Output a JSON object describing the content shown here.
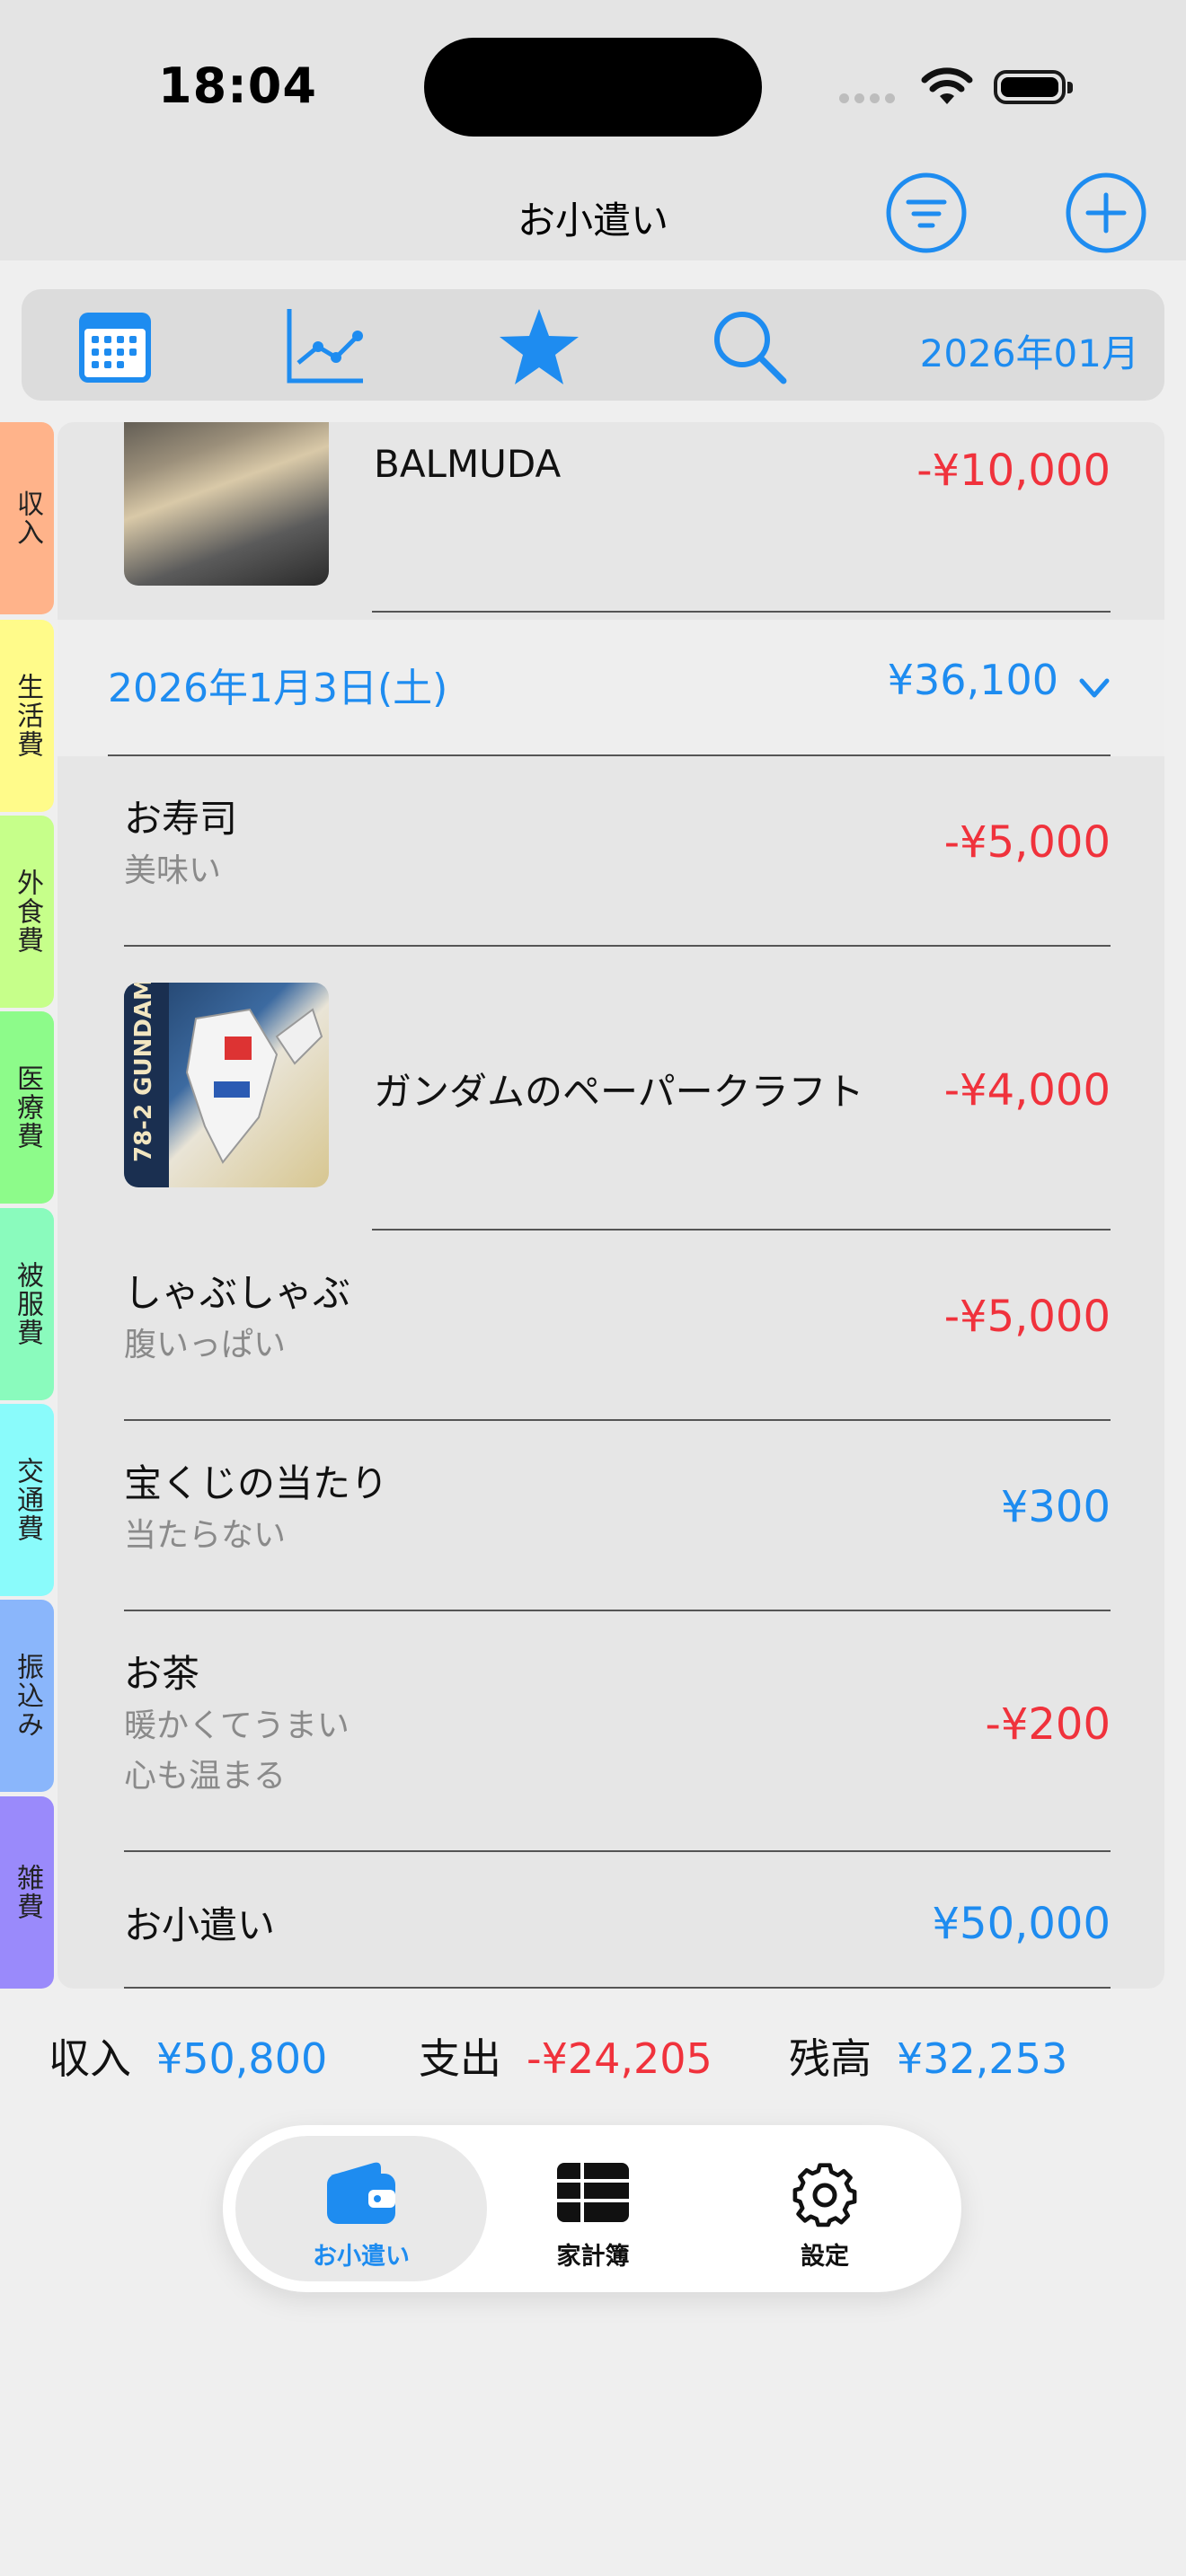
{
  "status": {
    "time": "18:04"
  },
  "nav": {
    "title": "お小遣い"
  },
  "toolbar": {
    "month": "2026年01月"
  },
  "categories": [
    {
      "label": "収入",
      "color": "#ffb38a"
    },
    {
      "label": "生活費",
      "color": "#fffb8a"
    },
    {
      "label": "外食費",
      "color": "#c6ff8a"
    },
    {
      "label": "医療費",
      "color": "#8dfb8a"
    },
    {
      "label": "被服費",
      "color": "#8afbbd"
    },
    {
      "label": "交通費",
      "color": "#8afbfb"
    },
    {
      "label": "振込み",
      "color": "#8ab6fb"
    },
    {
      "label": "雑費",
      "color": "#9a8afb"
    }
  ],
  "items": {
    "balmuda": {
      "title": "BALMUDA",
      "amount": "-¥10,000"
    },
    "day": {
      "date": "2026年1月3日(土)",
      "total": "¥36,100"
    },
    "sushi": {
      "title": "お寿司",
      "note": "美味い",
      "amount": "-¥5,000"
    },
    "gundam": {
      "title": "ガンダムのペーパークラフト",
      "amount": "-¥4,000",
      "image_text": "78-2 GUNDAM"
    },
    "shabu": {
      "title": "しゃぶしゃぶ",
      "note": "腹いっぱい",
      "amount": "-¥5,000"
    },
    "lottery": {
      "title": "宝くじの当たり",
      "note": "当たらない",
      "amount": "¥300"
    },
    "tea": {
      "title": "お茶",
      "note1": "暖かくてうまい",
      "note2": "心も温まる",
      "amount": "-¥200"
    },
    "allowance": {
      "title": "お小遣い",
      "amount": "¥50,000"
    }
  },
  "summary": {
    "income_label": "収入",
    "income": "¥50,800",
    "expense_label": "支出",
    "expense": "-¥24,205",
    "balance_label": "残高",
    "balance": "¥32,253"
  },
  "tabs": [
    {
      "label": "お小遣い",
      "active": true
    },
    {
      "label": "家計簿",
      "active": false
    },
    {
      "label": "設定",
      "active": false
    }
  ],
  "colors": {
    "accent": "#1e8cf0",
    "negative": "#f0323c"
  }
}
